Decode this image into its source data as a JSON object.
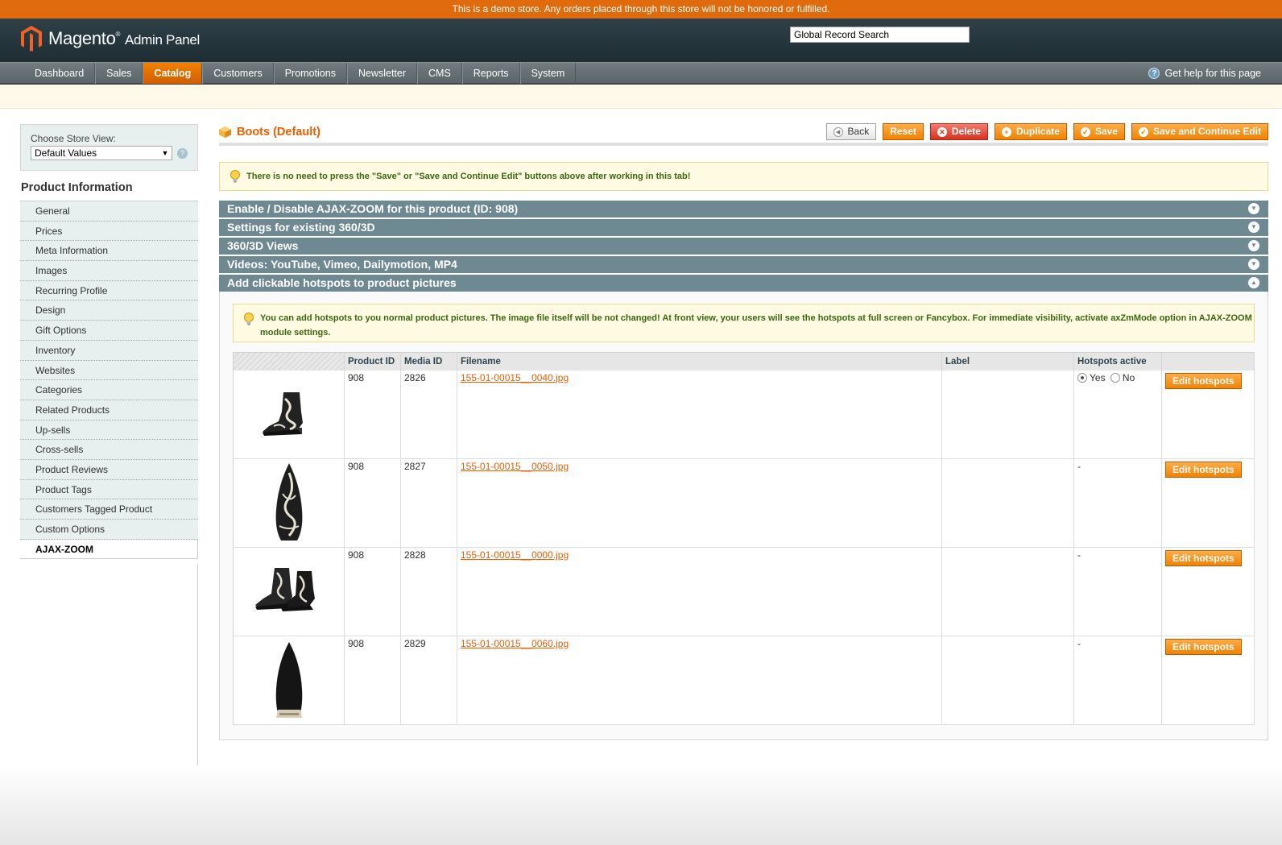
{
  "demo_notice": "This is a demo store. Any orders placed through this store will not be honored or fulfilled.",
  "header": {
    "logo_main": "Magento",
    "logo_sub": "Admin Panel",
    "search_value": "Global Record Search"
  },
  "nav": {
    "items": [
      "Dashboard",
      "Sales",
      "Catalog",
      "Customers",
      "Promotions",
      "Newsletter",
      "CMS",
      "Reports",
      "System"
    ],
    "active": "Catalog",
    "help": "Get help for this page"
  },
  "sidebar": {
    "store_label": "Choose Store View:",
    "store_value": "Default Values",
    "title": "Product Information",
    "items": [
      "General",
      "Prices",
      "Meta Information",
      "Images",
      "Recurring Profile",
      "Design",
      "Gift Options",
      "Inventory",
      "Websites",
      "Categories",
      "Related Products",
      "Up-sells",
      "Cross-sells",
      "Product Reviews",
      "Product Tags",
      "Customers Tagged Product",
      "Custom Options",
      "AJAX-ZOOM"
    ],
    "active": "AJAX-ZOOM"
  },
  "page": {
    "title": "Boots (Default)",
    "buttons": {
      "back": "Back",
      "reset": "Reset",
      "delete": "Delete",
      "duplicate": "Duplicate",
      "save": "Save",
      "save_continue": "Save and Continue Edit"
    },
    "tip": "There is no need to press the \"Save\" or \"Save and Continue Edit\" buttons above after working in this tab!"
  },
  "sections": [
    "Enable / Disable AJAX-ZOOM for this product (ID: 908)",
    "Settings for existing 360/3D",
    "360/3D Views",
    "Videos: YouTube, Vimeo, Dailymotion, MP4",
    "Add clickable hotspots to product pictures"
  ],
  "hotspots": {
    "info": "You can add hotspots to you normal product pictures. The image file itself will be not changed! At front view, your users will see the hotspots at full screen or Fancybox. For immediate visibility, activate axZmMode option in AJAX-ZOOM module settings.",
    "columns": [
      "Product ID",
      "Media ID",
      "Filename",
      "Label",
      "Hotspots active"
    ],
    "yes_label": "Yes",
    "no_label": "No",
    "edit_label": "Edit hotspots",
    "rows": [
      {
        "product_id": "908",
        "media_id": "2826",
        "filename": "155-01-00015__0040.jpg",
        "label": "",
        "active": "radio"
      },
      {
        "product_id": "908",
        "media_id": "2827",
        "filename": "155-01-00015__0050.jpg",
        "label": "",
        "active": "-"
      },
      {
        "product_id": "908",
        "media_id": "2828",
        "filename": "155-01-00015__0000.jpg",
        "label": "",
        "active": "-"
      },
      {
        "product_id": "908",
        "media_id": "2829",
        "filename": "155-01-00015__0060.jpg",
        "label": "",
        "active": "-"
      }
    ]
  }
}
